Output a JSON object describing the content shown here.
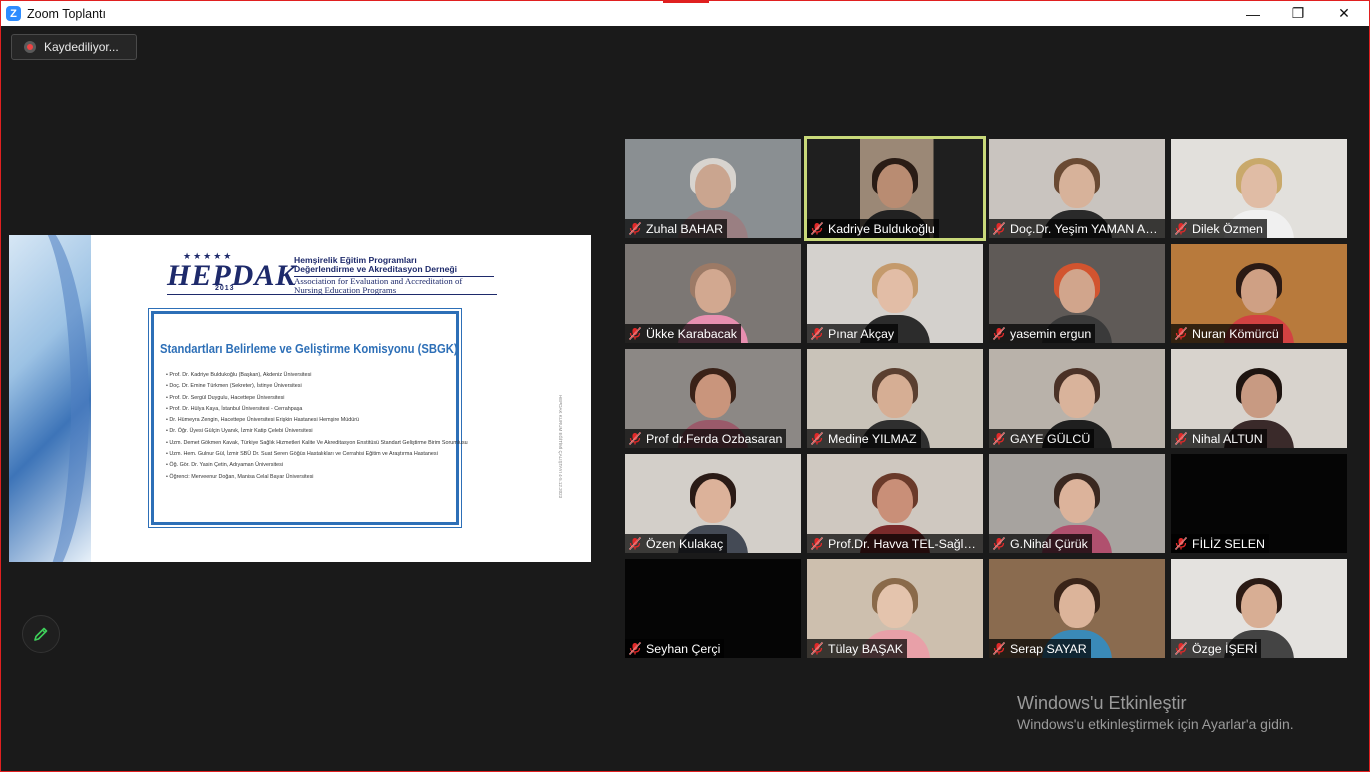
{
  "window": {
    "title": "Zoom Toplantı",
    "minimize": "—",
    "restore": "❐",
    "close": "✕"
  },
  "recording": {
    "label": "Kaydediliyor..."
  },
  "slide": {
    "logo_word": "HEPDAK",
    "logo_year": "2013",
    "logo_lines": [
      "Hemşirelik Eğitim Programları",
      "Değerlendirme ve Akreditasyon Derneği",
      "Association for Evaluation and Accreditation of",
      "Nursing Education Programs"
    ],
    "heading": "Standartları Belirleme ve Geliştirme Komisyonu (SBGK)",
    "members": [
      "Prof. Dr. Kadriye Buldukoğlu (Başkan), Akdeniz Üniversitesi",
      "Doç. Dr. Emine Türkmen (Sekreter), İstinye Üniversitesi",
      "Prof. Dr. Sergül Duygulu, Hacettepe Üniversitesi",
      "Prof. Dr. Hülya Kaya, İstanbul Üniversitesi - Cerrahpaşa",
      "Dr. Hümeyra Zengin, Hacettepe Üniversitesi Erişkin Hastanesi Hemşire Müdürü",
      "Dr. Öğr. Üyesi Gülçin Uyanık, İzmir Katip Çelebi Üniversitesi",
      "Uzm. Demet Gökmen Kavak, Türkiye Sağlık Hizmetleri Kalite Ve Akreditasyon Enstitüsü Standart Geliştirme Birim Sorumlusu",
      "Uzm. Hem. Gulnur Gül, İzmir SBÜ Dr. Suat Seren Göğüs Hastalıkları ve Cerrahisi Eğitim ve Araştırma Hastanesi",
      "Öğ. Gör. Dr. Yasin Çetin, Adıyaman Üniversitesi",
      "Öğrenci: Merveenur Doğan, Manisa Celal Bayar Üniversitesi"
    ],
    "side_text": "HEPDAK KURUM EĞİTİMİ ÇALIŞTAYI 4-5.12.2023"
  },
  "participants": [
    {
      "name": "Zuhal BAHAR",
      "bg": "#8a8f92",
      "skin": "#caa58f",
      "hair": "#d8d4cf",
      "cloth": "#9a7f82",
      "active": false
    },
    {
      "name": "Kadriye Buldukoğlu",
      "bg": "#1f1f1f",
      "skin": "#b98c72",
      "hair": "#2a1c15",
      "cloth": "#222222",
      "active": true
    },
    {
      "name": "Doç.Dr. Yeşim YAMAN AKTAŞ",
      "bg": "#c9c4bf",
      "skin": "#d7b29a",
      "hair": "#6a4a33",
      "cloth": "#2a2a2a",
      "active": false
    },
    {
      "name": "Dilek Özmen",
      "bg": "#e2e0dc",
      "skin": "#e0bca5",
      "hair": "#c9a96b",
      "cloth": "#f0f0f0",
      "active": false
    },
    {
      "name": "Ükke Karabacak",
      "bg": "#7c7774",
      "skin": "#d2a890",
      "hair": "#9c7a66",
      "cloth": "#e78fb0",
      "active": false
    },
    {
      "name": "Pınar Akçay",
      "bg": "#d4d1cd",
      "skin": "#e2bda6",
      "hair": "#c49a6c",
      "cloth": "#2c2c2c",
      "active": false
    },
    {
      "name": "yasemin ergun",
      "bg": "#5f5a57",
      "skin": "#d1a58c",
      "hair": "#d2542f",
      "cloth": "#3a3a3a",
      "active": false
    },
    {
      "name": "Nuran Kömürcü",
      "bg": "#b87a3c",
      "skin": "#cfa084",
      "hair": "#2b1a14",
      "cloth": "#d24242",
      "active": false
    },
    {
      "name": "Prof dr.Ferda Ozbasaran",
      "bg": "#8c8885",
      "skin": "#c9957c",
      "hair": "#3a2218",
      "cloth": "#9a5a6a",
      "active": false
    },
    {
      "name": "Medine YILMAZ",
      "bg": "#c9c3b9",
      "skin": "#d6ae94",
      "hair": "#5a3f30",
      "cloth": "#2f2f2f",
      "active": false
    },
    {
      "name": "GAYE GÜLCÜ",
      "bg": "#b9b2aa",
      "skin": "#d9b39b",
      "hair": "#4a3126",
      "cloth": "#1f1f1f",
      "active": false
    },
    {
      "name": "Nihal ALTUN",
      "bg": "#d8d3cd",
      "skin": "#c89a82",
      "hair": "#1e1410",
      "cloth": "#3a2a2a",
      "active": false
    },
    {
      "name": "Özen Kulakaç",
      "bg": "#d3cfc9",
      "skin": "#dcb29a",
      "hair": "#2a1b16",
      "cloth": "#444a55",
      "active": false
    },
    {
      "name": "Prof.Dr. Havva TEL-Sağlık Bilimleri",
      "bg": "#cfc8c0",
      "skin": "#c98f78",
      "hair": "#6a3a2a",
      "cloth": "#7a2a2a",
      "active": false
    },
    {
      "name": "G.Nihal Çürük",
      "bg": "#a7a39f",
      "skin": "#dcb39b",
      "hair": "#3a2820",
      "cloth": "#b0506e",
      "active": false
    },
    {
      "name": "FİLİZ SELEN",
      "bg": "#050505",
      "skin": "#050505",
      "hair": "#050505",
      "cloth": "#050505",
      "active": false
    },
    {
      "name": "Seyhan Çerçi",
      "bg": "#050505",
      "skin": "#050505",
      "hair": "#050505",
      "cloth": "#050505",
      "active": false
    },
    {
      "name": "Tülay BAŞAK",
      "bg": "#cdbfae",
      "skin": "#e4c4ad",
      "hair": "#8a6a4a",
      "cloth": "#e8a0a8",
      "active": false
    },
    {
      "name": "Serap SAYAR",
      "bg": "#8a6b4f",
      "skin": "#dcb49a",
      "hair": "#3a2418",
      "cloth": "#3a8ab8",
      "active": false
    },
    {
      "name": "Özge  İŞERİ",
      "bg": "#e4e2df",
      "skin": "#d8ae94",
      "hair": "#2a1a14",
      "cloth": "#444444",
      "active": false
    }
  ],
  "watermark": {
    "title": "Windows'u Etkinleştir",
    "subtitle": "Windows'u etkinleştirmek için Ayarlar'a gidin."
  }
}
